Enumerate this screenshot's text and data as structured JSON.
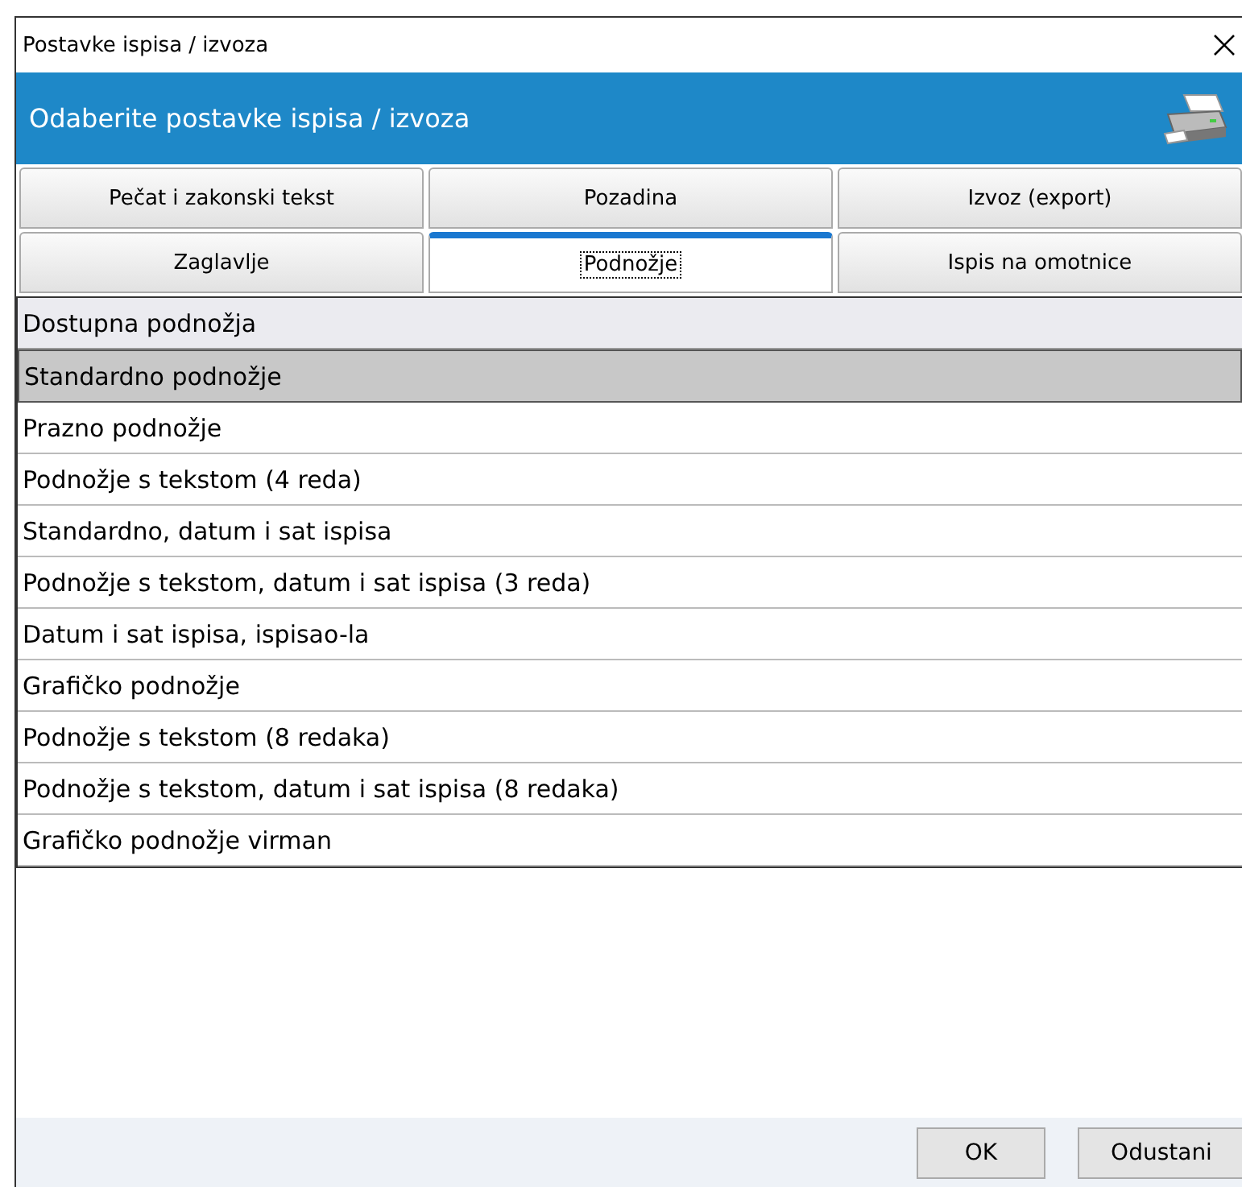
{
  "window": {
    "title": "Postavke ispisa / izvoza"
  },
  "header": {
    "title": "Odaberite postavke ispisa / izvoza"
  },
  "tabs": [
    {
      "label": "Pečat i zakonski tekst",
      "selected": false
    },
    {
      "label": "Pozadina",
      "selected": false
    },
    {
      "label": "Izvoz (export)",
      "selected": false
    },
    {
      "label": "Zaglavlje",
      "selected": false
    },
    {
      "label": "Podnožje",
      "selected": true
    },
    {
      "label": "Ispis na omotnice",
      "selected": false
    }
  ],
  "list": {
    "heading": "Dostupna podnožja",
    "items": [
      {
        "label": "Standardno podnožje",
        "selected": true
      },
      {
        "label": "Prazno podnožje",
        "selected": false
      },
      {
        "label": "Podnožje s tekstom (4 reda)",
        "selected": false
      },
      {
        "label": "Standardno, datum i sat ispisa",
        "selected": false
      },
      {
        "label": "Podnožje s tekstom, datum i sat ispisa (3 reda)",
        "selected": false
      },
      {
        "label": "Datum i sat ispisa, ispisao-la",
        "selected": false
      },
      {
        "label": "Grafičko podnožje",
        "selected": false
      },
      {
        "label": "Podnožje s tekstom (8 redaka)",
        "selected": false
      },
      {
        "label": "Podnožje s tekstom, datum i sat ispisa (8 redaka)",
        "selected": false
      },
      {
        "label": "Grafičko podnožje virman",
        "selected": false
      }
    ]
  },
  "buttons": [
    "OK",
    "Odustani"
  ]
}
